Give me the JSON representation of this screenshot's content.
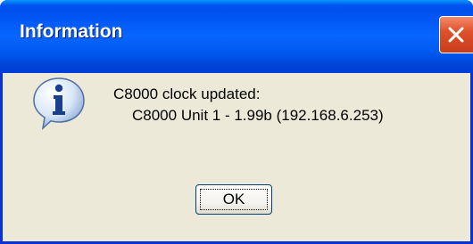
{
  "window": {
    "title": "Information"
  },
  "dialog": {
    "icon": "info-icon",
    "message_line1": "C8000 clock updated:",
    "message_line2": "C8000 Unit 1 - 1.99b (192.168.6.253)"
  },
  "buttons": {
    "ok_label": "OK"
  },
  "colors": {
    "titlebar": "#0058ee",
    "client_bg": "#ece9d8",
    "close_button": "#e0512c",
    "frame": "#0831d9"
  }
}
